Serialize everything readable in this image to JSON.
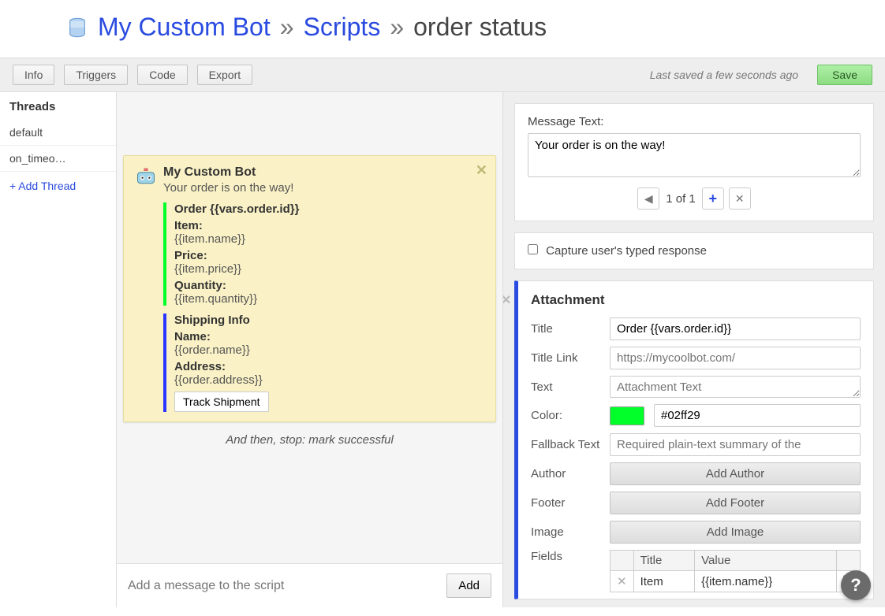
{
  "breadcrumb": {
    "root": "My Custom Bot",
    "section": "Scripts",
    "current": "order status"
  },
  "toolbar": {
    "info": "Info",
    "triggers": "Triggers",
    "code": "Code",
    "export": "Export",
    "saved_text": "Last saved a few seconds ago",
    "save": "Save"
  },
  "sidebar": {
    "title": "Threads",
    "items": [
      "default",
      "on_timeo…"
    ],
    "add": "+ Add Thread"
  },
  "preview": {
    "bot_name": "My Custom Bot",
    "message": "Your order is on the way!",
    "attachments": [
      {
        "color": "#02ff29",
        "title": "Order {{vars.order.id}}",
        "fields": [
          {
            "label": "Item:",
            "value": "{{item.name}}"
          },
          {
            "label": "Price:",
            "value": "{{item.price}}"
          },
          {
            "label": "Quantity:",
            "value": "{{item.quantity}}"
          }
        ]
      },
      {
        "color": "#2a36ff",
        "title": "Shipping Info",
        "fields": [
          {
            "label": "Name:",
            "value": "{{order.name}}"
          },
          {
            "label": "Address:",
            "value": "{{order.address}}"
          }
        ],
        "action_label": "Track Shipment"
      }
    ],
    "then_stop": "And then, stop: mark successful",
    "add_placeholder": "Add a message to the script",
    "add_btn": "Add"
  },
  "editor": {
    "msg_label": "Message Text:",
    "msg_value": "Your order is on the way!",
    "pager": "1 of 1",
    "capture_label": "Capture user's typed response",
    "attachment": {
      "heading": "Attachment",
      "labels": {
        "title": "Title",
        "title_link": "Title Link",
        "text": "Text",
        "color": "Color:",
        "fallback": "Fallback Text",
        "author": "Author",
        "footer": "Footer",
        "image": "Image",
        "fields": "Fields"
      },
      "values": {
        "title": "Order {{vars.order.id}}",
        "title_link_placeholder": "https://mycoolbot.com/",
        "text_placeholder": "Attachment Text",
        "color_swatch": "#02ff29",
        "color_value": "#02ff29",
        "fallback_placeholder": "Required plain-text summary of the",
        "add_author": "Add Author",
        "add_footer": "Add Footer",
        "add_image": "Add Image"
      },
      "fields_table": {
        "headers": {
          "title": "Title",
          "value": "Value"
        },
        "rows": [
          {
            "title": "Item",
            "value": "{{item.name}}"
          }
        ]
      }
    }
  }
}
